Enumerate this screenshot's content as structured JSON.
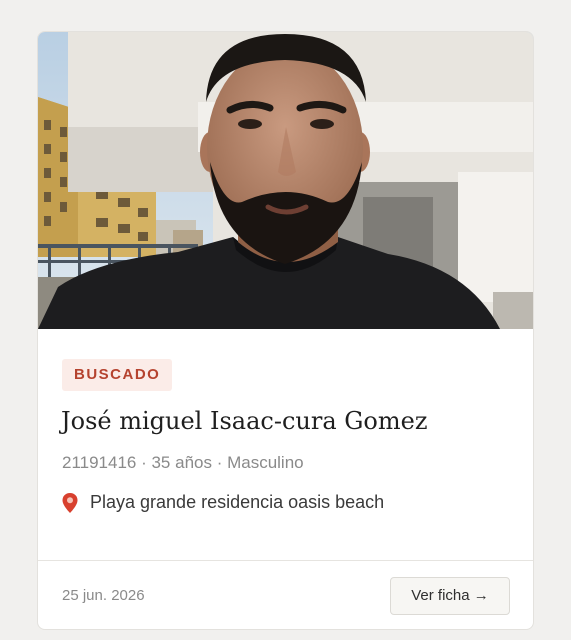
{
  "card": {
    "photo_alt": "profile photo",
    "status_badge": "BUSCADO",
    "name": "José miguel Isaac-cura Gomez",
    "meta": "21191416 · 35 años · Masculino",
    "location_icon": "pin-icon",
    "location": "Playa grande residencia oasis beach",
    "date": "25 jun. 2026",
    "view_button": "Ver ficha →"
  },
  "colors": {
    "badge_bg": "#fbece8",
    "badge_text": "#b5432f",
    "pin": "#d8402e"
  }
}
